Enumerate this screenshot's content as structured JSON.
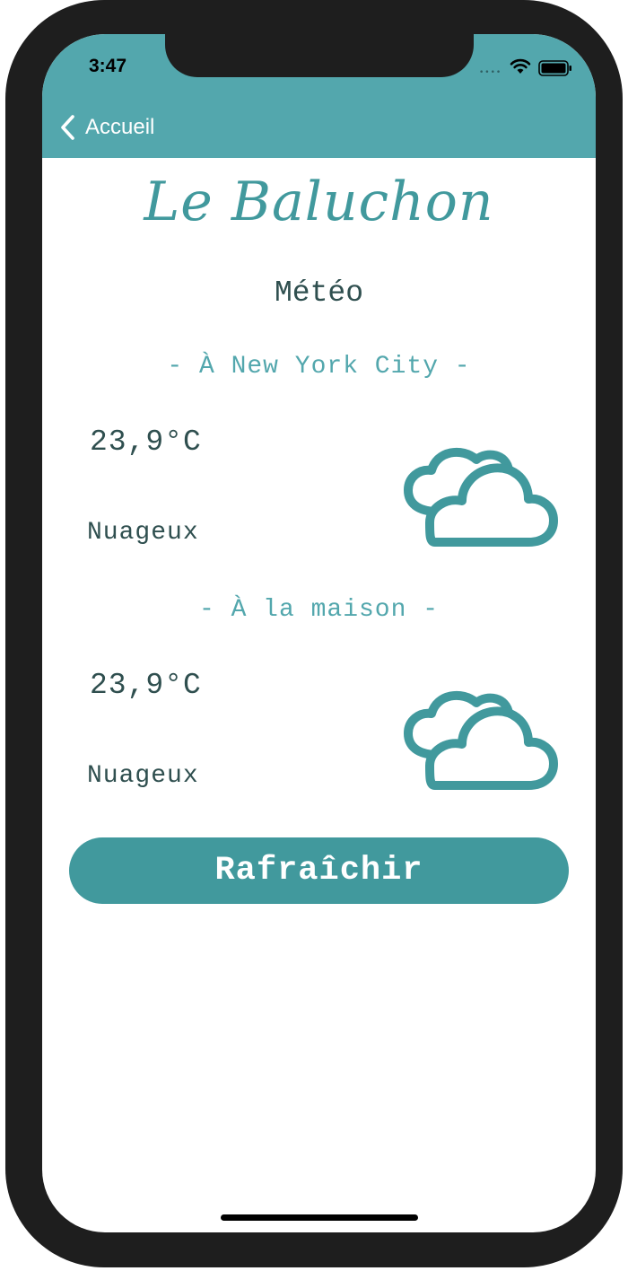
{
  "status_bar": {
    "time": "3:47",
    "signal": "••••"
  },
  "nav": {
    "back_label": "Accueil",
    "back_icon": "chevron-left-icon"
  },
  "app": {
    "logo": "Le Baluchon",
    "title": "Météo"
  },
  "locations": [
    {
      "heading": "- À New York City -",
      "temperature": "23,9°C",
      "condition": "Nuageux",
      "icon": "clouds-icon"
    },
    {
      "heading": "- À la maison -",
      "temperature": "23,9°C",
      "condition": "Nuageux",
      "icon": "clouds-icon"
    }
  ],
  "actions": {
    "refresh_label": "Rafraîchir"
  },
  "colors": {
    "accent": "#53a7ad",
    "button": "#41999d",
    "text": "#2f4f4f",
    "frame": "#1e1e1e"
  }
}
